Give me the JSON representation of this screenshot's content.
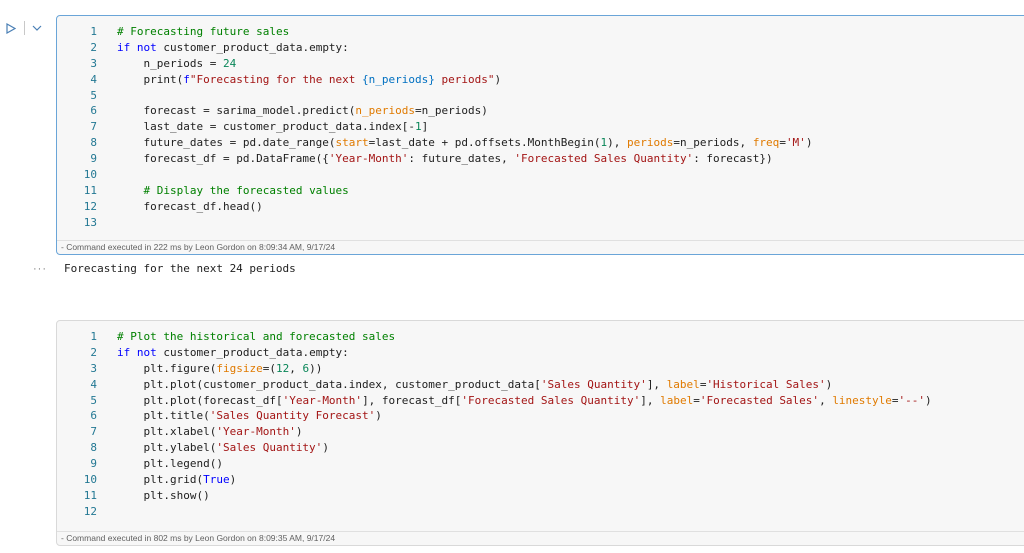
{
  "cell1": {
    "lines": [
      "# Forecasting future sales",
      "if not customer_product_data.empty:",
      "    n_periods = 24",
      "    print(f\"Forecasting for the next {n_periods} periods\")",
      "",
      "    forecast = sarima_model.predict(n_periods=n_periods)",
      "    last_date = customer_product_data.index[-1]",
      "    future_dates = pd.date_range(start=last_date + pd.offsets.MonthBegin(1), periods=n_periods, freq='M')",
      "    forecast_df = pd.DataFrame({'Year-Month': future_dates, 'Forecasted Sales Quantity': forecast})",
      "",
      "    # Display the forecasted values",
      "    forecast_df.head()",
      ""
    ],
    "status": "- Command executed in 222 ms by Leon Gordon on 8:09:34 AM, 9/17/24"
  },
  "output": {
    "dots": "···",
    "text": "Forecasting for the next 24 periods"
  },
  "cell2": {
    "lines": [
      "# Plot the historical and forecasted sales",
      "if not customer_product_data.empty:",
      "    plt.figure(figsize=(12, 6))",
      "    plt.plot(customer_product_data.index, customer_product_data['Sales Quantity'], label='Historical Sales')",
      "    plt.plot(forecast_df['Year-Month'], forecast_df['Forecasted Sales Quantity'], label='Forecasted Sales', linestyle='--')",
      "    plt.title('Sales Quantity Forecast')",
      "    plt.xlabel('Year-Month')",
      "    plt.ylabel('Sales Quantity')",
      "    plt.legend()",
      "    plt.grid(True)",
      "    plt.show()",
      ""
    ],
    "status": "- Command executed in 802 ms by Leon Gordon on 8:09:35 AM, 9/17/24"
  },
  "icons": {
    "run": "play-icon",
    "collapse": "chevron-down-icon"
  },
  "colors": {
    "active_border": "#6aa5d8",
    "line_number": "#237893",
    "keyword": "#0000ff",
    "comment": "#008000",
    "string": "#a31515",
    "number": "#098658"
  }
}
